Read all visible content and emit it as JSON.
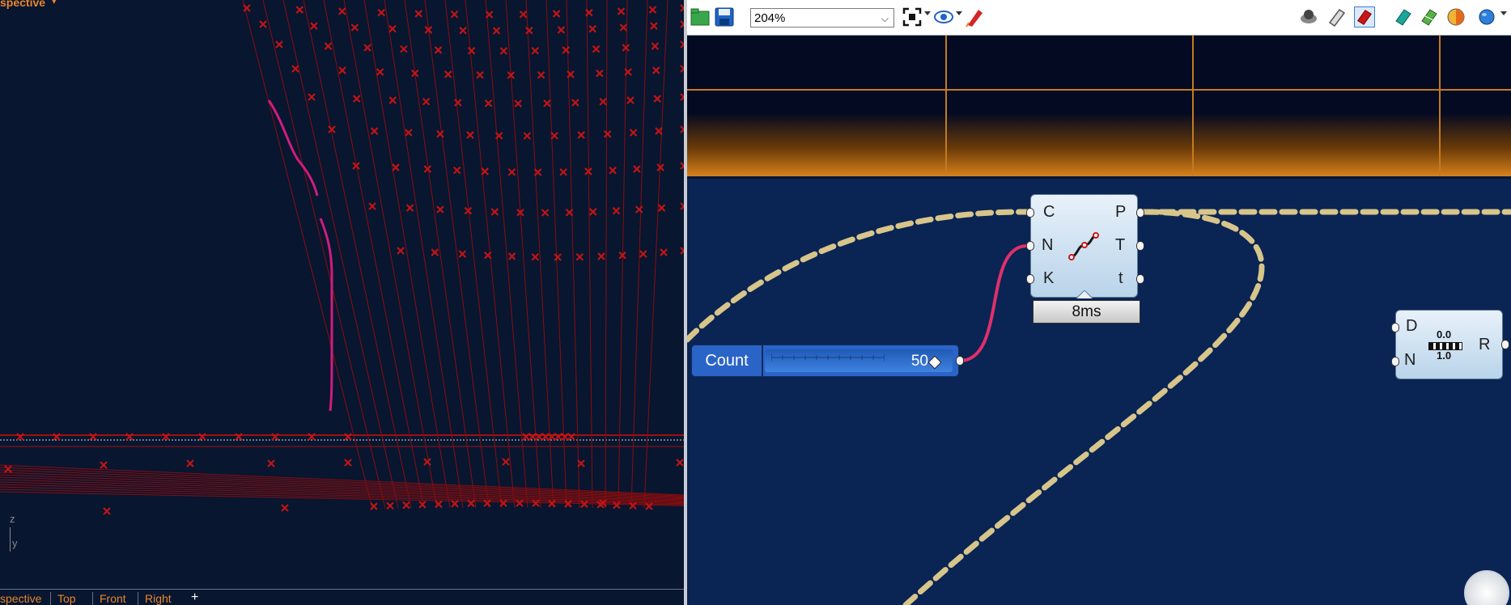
{
  "viewport": {
    "title": "spective",
    "axes": {
      "z": "z",
      "y": "y"
    },
    "tabs": [
      "spective",
      "Top",
      "Front",
      "Right"
    ],
    "add_tab": "+"
  },
  "toolbar": {
    "zoom": "204%",
    "icons": [
      "open-file-icon",
      "save-icon",
      "zoom-extents-icon",
      "preview-eye-icon",
      "sketch-pen-icon",
      "preview-off-icon",
      "preview-wireframe-icon",
      "preview-shaded-icon",
      "preview-selected-icon",
      "preview-mesh-icon",
      "material-icon",
      "sphere-icon"
    ]
  },
  "canvas": {
    "divide_curve": {
      "inputs": [
        "C",
        "N",
        "K"
      ],
      "outputs": [
        "P",
        "T",
        "t"
      ],
      "timer": "8ms"
    },
    "slider": {
      "name": "Count",
      "value": "50"
    },
    "range": {
      "inputs": [
        "D",
        "N"
      ],
      "outputs": [
        "R"
      ],
      "icon_top": "0.0",
      "icon_bottom": "1.0"
    }
  },
  "colors": {
    "viewport_bg": "#081630",
    "canvas_bg": "#0a2454",
    "accent_orange": "#e8862a",
    "points_red": "#b01010",
    "wire_pink": "#e0306a",
    "dashed_wire": "#d7c58a"
  }
}
